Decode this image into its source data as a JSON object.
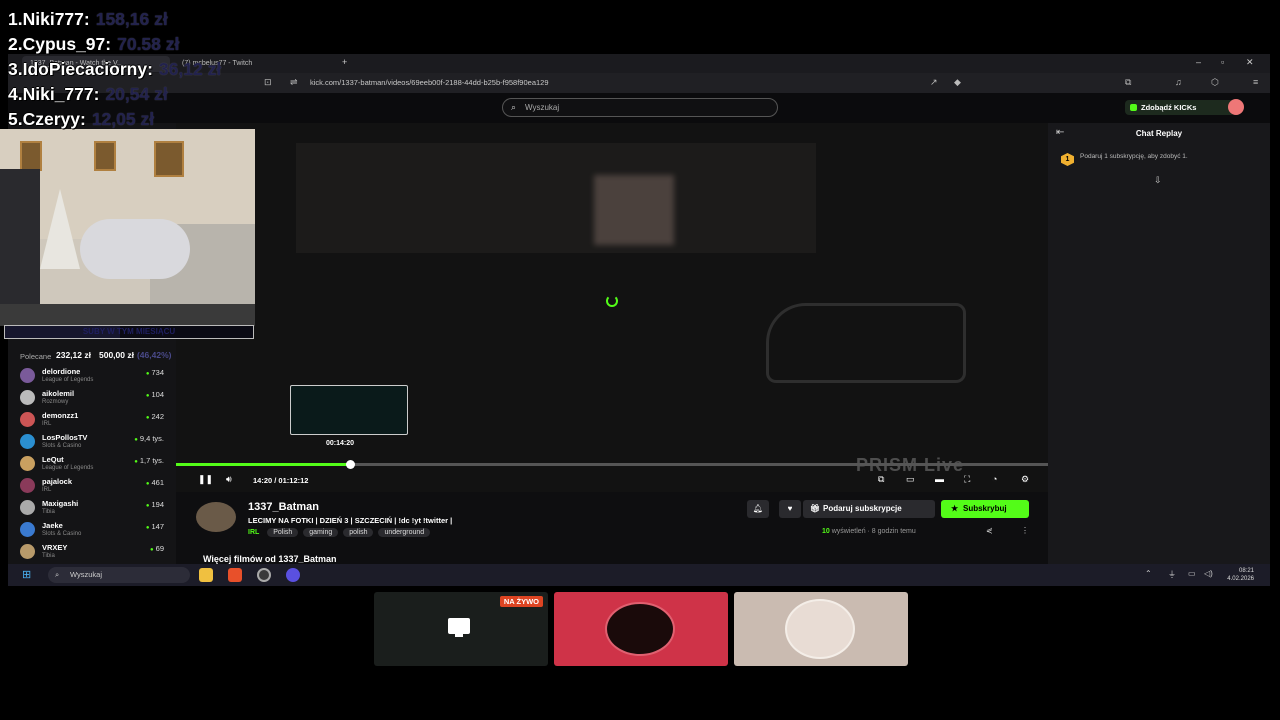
{
  "browser": {
    "tabs": [
      "1337_Batman - Watch the V...",
      "(7) mcbelus77 - Twitch"
    ],
    "url": "kick.com/1337-batman/videos/69eeb00f-2188-44dd-b25b-f958f90ea129"
  },
  "kick_header": {
    "search_placeholder": "Wyszukaj",
    "get_kicks_label": "Zdobądź KICKs"
  },
  "sidebar": {
    "recommended_label": "Polecane",
    "items": [
      {
        "name": "delordione",
        "category": "League of Legends",
        "viewers": "734"
      },
      {
        "name": "aikolemil",
        "category": "Rozmowy",
        "viewers": "104"
      },
      {
        "name": "demonzz1",
        "category": "IRL",
        "viewers": "242"
      },
      {
        "name": "LosPollosTV",
        "category": "Slots & Casino",
        "viewers": "9,4 tys."
      },
      {
        "name": "LeQut",
        "category": "League of Legends",
        "viewers": "1,7 tys."
      },
      {
        "name": "pajalock",
        "category": "IRL",
        "viewers": "461"
      },
      {
        "name": "Maxigashi",
        "category": "Tibia",
        "viewers": "194"
      },
      {
        "name": "Jaeke",
        "category": "Slots & Casino",
        "viewers": "147"
      },
      {
        "name": "VRXEY",
        "category": "Tibia",
        "viewers": "69"
      }
    ]
  },
  "player": {
    "preview_time": "00:14:20",
    "timecode": "14:20 / 01:12:12",
    "progress": 0.2,
    "watermark": "PRISM Live"
  },
  "chat": {
    "title": "Chat Replay",
    "badge": "1",
    "message": "Podaruj 1 subskrypcję, aby zdobyć 1."
  },
  "video_info": {
    "channel": "1337_Batman",
    "title": "LECIMY NA FOTKI | DZIEŃ 3 | SZCZECIŃ | !dc !yt !twitter |",
    "category": "IRL",
    "tags": [
      "Polish",
      "gaming",
      "polish",
      "underground"
    ],
    "gift_label": "Podaruj subskrypcje",
    "subscribe_label": "Subskrybuj",
    "views_count": "10",
    "views_rest": " wyświetleń  ·  8 godzin temu",
    "more_videos": "Więcej filmów od 1337_Batman"
  },
  "taskbar": {
    "search_placeholder": "Wyszukaj",
    "time": "08:21",
    "date": "4.02.2026"
  },
  "leaderboard": [
    {
      "name": "1.Niki777:",
      "amount": "158,16 zł"
    },
    {
      "name": "2.Cypus_97:",
      "amount": "70.58 zł"
    },
    {
      "name": "3.IdoPiecaciorny:",
      "amount": "36,12 zł"
    },
    {
      "name": "4.Niki_777:",
      "amount": "20,54 zł"
    },
    {
      "name": "5.Czeryy:",
      "amount": "12,05 zł"
    }
  ],
  "goal": {
    "label": "SUBY W TYM MIESIĄCU",
    "current": "232,12 zł",
    "target": "500,00 zł",
    "percent_text": "(46,42%)",
    "fraction": 0.4642
  },
  "bottom_tiles": {
    "live_label": "NA ŻYWO"
  }
}
